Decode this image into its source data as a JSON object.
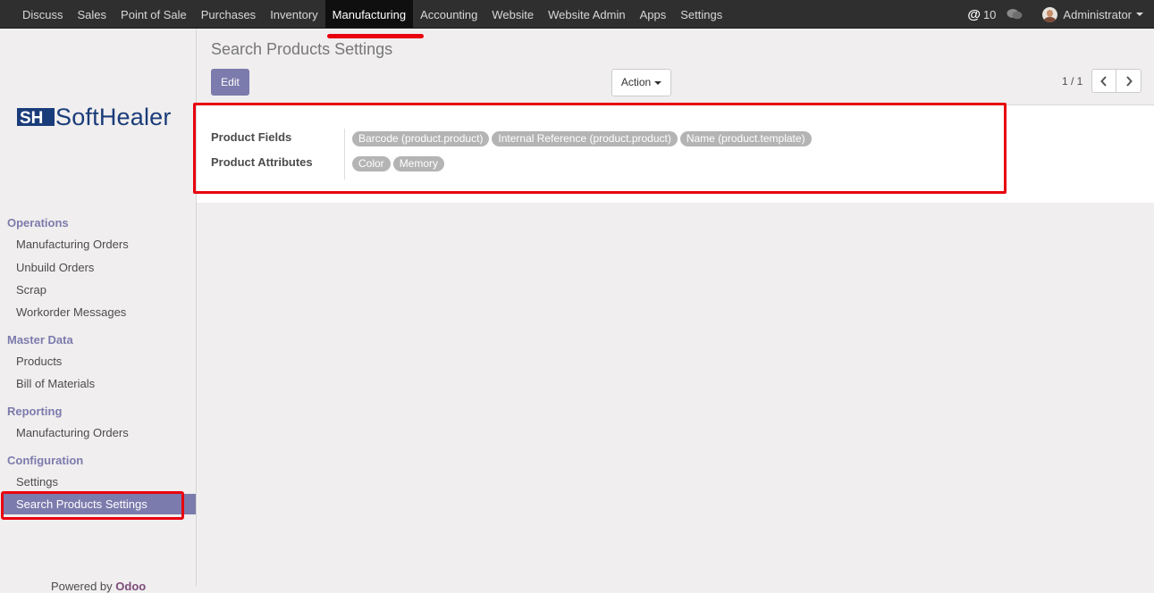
{
  "navbar": {
    "menu": [
      "Discuss",
      "Sales",
      "Point of Sale",
      "Purchases",
      "Inventory",
      "Manufacturing",
      "Accounting",
      "Website",
      "Website Admin",
      "Apps",
      "Settings"
    ],
    "active_menu": "Manufacturing",
    "messages_count": "10",
    "user_name": "Administrator"
  },
  "brand": {
    "logo_text": "SoftHealer"
  },
  "sidebar": {
    "sections": [
      {
        "title": "Operations",
        "items": [
          "Manufacturing Orders",
          "Unbuild Orders",
          "Scrap",
          "Workorder Messages"
        ]
      },
      {
        "title": "Master Data",
        "items": [
          "Products",
          "Bill of Materials"
        ]
      },
      {
        "title": "Reporting",
        "items": [
          "Manufacturing Orders"
        ]
      },
      {
        "title": "Configuration",
        "items": [
          "Settings",
          "Search Products Settings"
        ]
      }
    ],
    "active_item": "Search Products Settings",
    "powered_by_prefix": "Powered by",
    "powered_by_brand": "Odoo"
  },
  "page": {
    "title": "Search Products Settings",
    "edit_label": "Edit",
    "action_label": "Action",
    "pager": "1 / 1"
  },
  "form": {
    "product_fields_label": "Product Fields",
    "product_fields": [
      "Barcode (product.product)",
      "Internal Reference (product.product)",
      "Name (product.template)"
    ],
    "product_attributes_label": "Product Attributes",
    "product_attributes": [
      "Color",
      "Memory"
    ]
  },
  "colors": {
    "navbar_bg": "#2f2f2f",
    "accent": "#7c7bad",
    "highlight_red": "#e8000e",
    "tag_bg": "#b4b4b4"
  }
}
